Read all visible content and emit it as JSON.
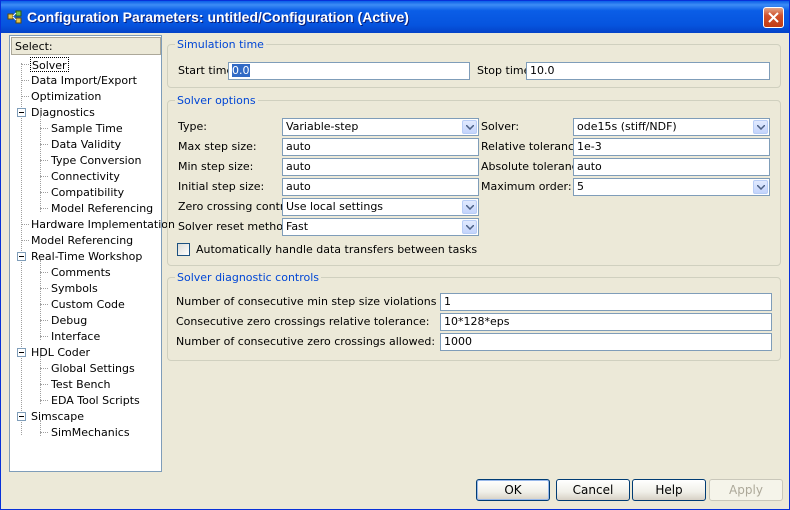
{
  "window": {
    "title": "Configuration Parameters: untitled/Configuration (Active)"
  },
  "tree": {
    "header": "Select:",
    "items": [
      {
        "label": "Solver"
      },
      {
        "label": "Data Import/Export"
      },
      {
        "label": "Optimization"
      },
      {
        "label": "Diagnostics"
      },
      {
        "label": "Sample Time"
      },
      {
        "label": "Data Validity"
      },
      {
        "label": "Type Conversion"
      },
      {
        "label": "Connectivity"
      },
      {
        "label": "Compatibility"
      },
      {
        "label": "Model Referencing"
      },
      {
        "label": "Hardware Implementation"
      },
      {
        "label": "Model Referencing"
      },
      {
        "label": "Real-Time Workshop"
      },
      {
        "label": "Comments"
      },
      {
        "label": "Symbols"
      },
      {
        "label": "Custom Code"
      },
      {
        "label": "Debug"
      },
      {
        "label": "Interface"
      },
      {
        "label": "HDL Coder"
      },
      {
        "label": "Global Settings"
      },
      {
        "label": "Test Bench"
      },
      {
        "label": "EDA Tool Scripts"
      },
      {
        "label": "Simscape"
      },
      {
        "label": "SimMechanics"
      }
    ]
  },
  "simulation_time": {
    "title": "Simulation time",
    "start_label": "Start time:",
    "start_value": "0.0",
    "stop_label": "Stop time:",
    "stop_value": "10.0"
  },
  "solver_options": {
    "title": "Solver options",
    "type_label": "Type:",
    "type_value": "Variable-step",
    "solver_label": "Solver:",
    "solver_value": "ode15s (stiff/NDF)",
    "max_step_label": "Max step size:",
    "max_step_value": "auto",
    "rel_tol_label": "Relative tolerance:",
    "rel_tol_value": "1e-3",
    "min_step_label": "Min step size:",
    "min_step_value": "auto",
    "abs_tol_label": "Absolute tolerance:",
    "abs_tol_value": "auto",
    "init_step_label": "Initial step size:",
    "init_step_value": "auto",
    "max_order_label": "Maximum order:",
    "max_order_value": "5",
    "zero_cross_label": "Zero crossing control:",
    "zero_cross_value": "Use local settings",
    "reset_label": "Solver reset method:",
    "reset_value": "Fast",
    "auto_handle_label": "Automatically handle data transfers between tasks"
  },
  "diagnostic_controls": {
    "title": "Solver diagnostic controls",
    "min_step_viol_label": "Number of consecutive min step size violations allowed:",
    "min_step_viol_value": "1",
    "zc_rel_tol_label": "Consecutive zero crossings relative tolerance:",
    "zc_rel_tol_value": "10*128*eps",
    "zc_allowed_label": "Number of consecutive zero crossings allowed:",
    "zc_allowed_value": "1000"
  },
  "buttons": {
    "ok": "OK",
    "cancel": "Cancel",
    "help": "Help",
    "apply": "Apply"
  },
  "colors": {
    "title_bar": "#0654de",
    "group_title": "#0046d5",
    "selection": "#316ac5"
  }
}
